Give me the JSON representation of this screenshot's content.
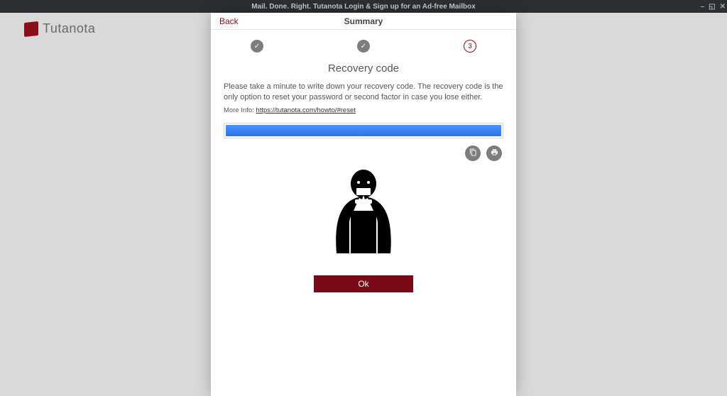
{
  "window": {
    "title": "Mail. Done. Right. Tutanota Login & Sign up for an Ad-free Mailbox"
  },
  "brand": {
    "name": "Tutanota"
  },
  "modal": {
    "back_label": "Back",
    "title": "Summary",
    "steps": {
      "step1": "✓",
      "step2": "✓",
      "step3": "3"
    },
    "section_title": "Recovery code",
    "instruction": "Please take a minute to write down your recovery code. The recovery code is the only option to reset your password or second factor in case you lose either.",
    "more_info_label": "More Info:",
    "more_info_link_text": "https://tutanota.com/howto/#reset",
    "ok_label": "Ok"
  }
}
